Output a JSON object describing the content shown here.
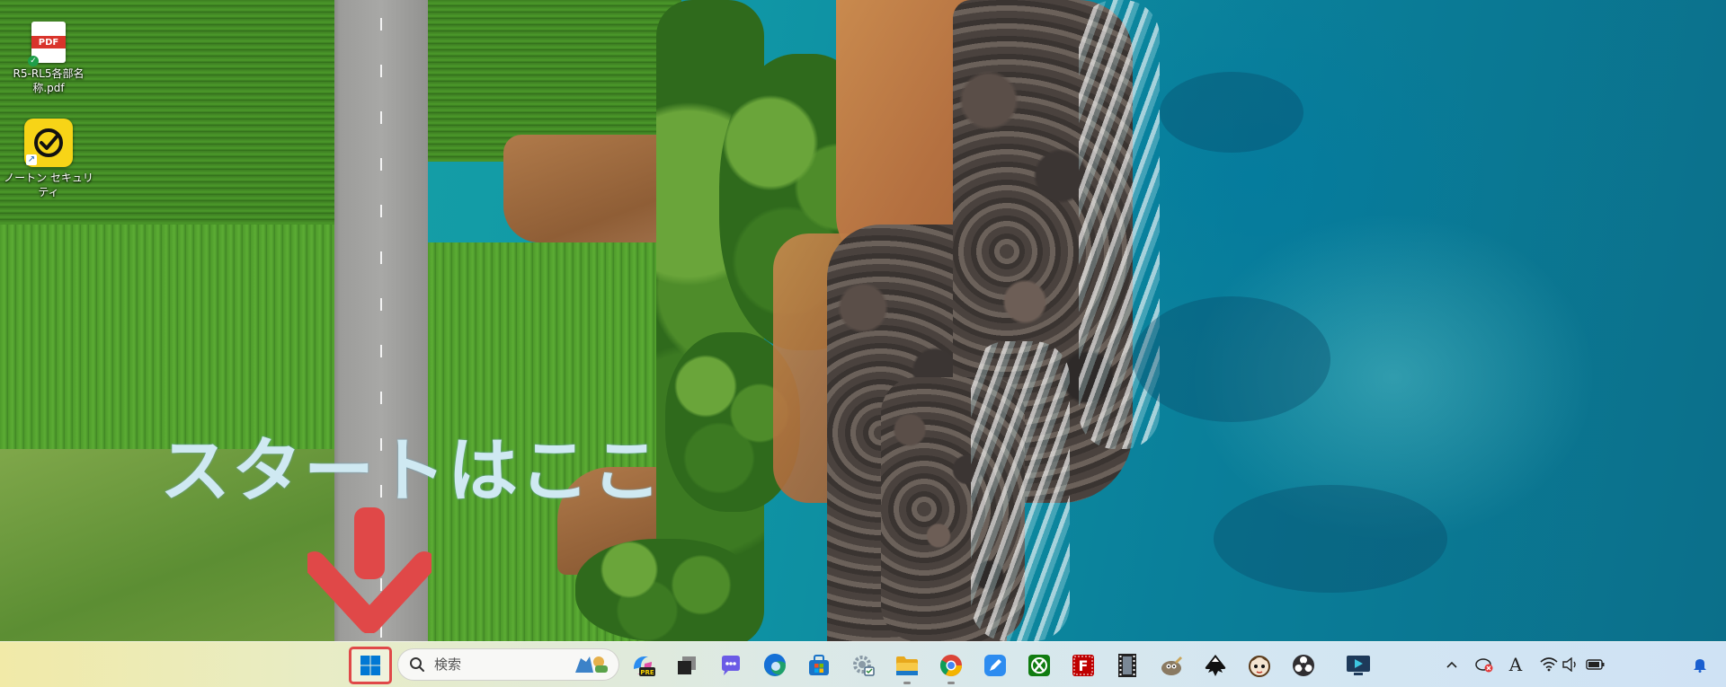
{
  "desktop": {
    "icons": [
      {
        "label": "R5-RL5各部名称.pdf",
        "icon": "pdf-file-icon",
        "badge": "PDF"
      },
      {
        "label": "ノートン セキュリティ",
        "icon": "norton-security-icon"
      }
    ]
  },
  "annotation": {
    "text": "スタートはここ",
    "arrow": "down-arrow-icon",
    "highlight_color": "#e04848"
  },
  "taskbar": {
    "start_icon": "windows-start-icon",
    "search": {
      "placeholder": "検索",
      "icon": "search-icon"
    },
    "apps": [
      {
        "name": "copilot-pre-icon",
        "badge": "PRE"
      },
      {
        "name": "task-view-icon"
      },
      {
        "name": "chat-icon"
      },
      {
        "name": "edge-icon"
      },
      {
        "name": "microsoft-store-icon"
      },
      {
        "name": "settings-icon"
      },
      {
        "name": "file-explorer-icon",
        "running": true
      },
      {
        "name": "chrome-icon",
        "running": true
      },
      {
        "name": "pen-app-icon"
      },
      {
        "name": "xbox-icon"
      },
      {
        "name": "filezilla-icon"
      },
      {
        "name": "film-editor-icon"
      },
      {
        "name": "gimp-icon"
      },
      {
        "name": "inkscape-icon"
      },
      {
        "name": "character-app-icon"
      },
      {
        "name": "obs-icon"
      },
      {
        "name": "screen-capture-icon"
      }
    ],
    "tray": {
      "overflow_icon": "chevron-up-icon",
      "network_error_icon": "network-error-icon",
      "ime_label": "A",
      "wifi_icon": "wifi-icon",
      "volume_icon": "volume-icon",
      "battery_icon": "battery-icon",
      "notification_icon": "bell-icon"
    }
  },
  "colors": {
    "ocean": "#1097a6",
    "field": "#4c9a2a",
    "annotation_text": "#cfe9f2",
    "highlight": "#e04848"
  }
}
